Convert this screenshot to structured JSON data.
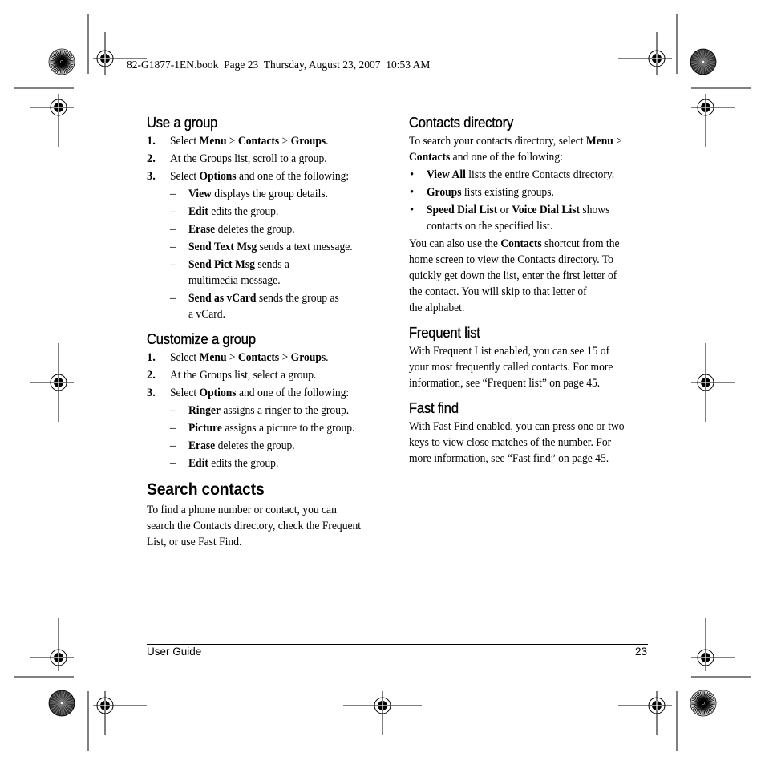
{
  "slug_line": "82-G1877-1EN.book  Page 23  Thursday, August 23, 2007  10:53 AM",
  "left_column": {
    "use_group": {
      "heading": "Use a group",
      "steps": [
        {
          "num": "1.",
          "parts": [
            {
              "t": "Select "
            },
            {
              "b": "Menu"
            },
            {
              "t": " > "
            },
            {
              "b": "Contacts"
            },
            {
              "t": " > "
            },
            {
              "b": "Groups"
            },
            {
              "t": "."
            }
          ]
        },
        {
          "num": "2.",
          "parts": [
            {
              "t": "At the Groups list, scroll to a group."
            }
          ]
        },
        {
          "num": "3.",
          "parts": [
            {
              "t": "Select "
            },
            {
              "b": "Options"
            },
            {
              "t": " and one of the following:"
            }
          ],
          "subs": [
            {
              "bold": "View",
              "rest": " displays the group details."
            },
            {
              "bold": "Edit",
              "rest": " edits the group."
            },
            {
              "bold": "Erase",
              "rest": " deletes the group."
            },
            {
              "bold": "Send Text Msg",
              "rest": " sends a text message."
            },
            {
              "bold": "Send Pict Msg",
              "rest": " sends a",
              "line2": "multimedia message."
            },
            {
              "bold": "Send as vCard",
              "rest": " sends the group as",
              "line2": "a vCard."
            }
          ]
        }
      ]
    },
    "customize_group": {
      "heading": "Customize a group",
      "steps": [
        {
          "num": "1.",
          "parts": [
            {
              "t": "Select "
            },
            {
              "b": "Menu"
            },
            {
              "t": " > "
            },
            {
              "b": "Contacts"
            },
            {
              "t": " > "
            },
            {
              "b": "Groups"
            },
            {
              "t": "."
            }
          ]
        },
        {
          "num": "2.",
          "parts": [
            {
              "t": "At the Groups list, select a group."
            }
          ]
        },
        {
          "num": "3.",
          "parts": [
            {
              "t": "Select "
            },
            {
              "b": "Options"
            },
            {
              "t": " and one of the following:"
            }
          ],
          "subs": [
            {
              "bold": "Ringer",
              "rest": " assigns a ringer to the group."
            },
            {
              "bold": "Picture",
              "rest": " assigns a picture to the group."
            },
            {
              "bold": "Erase",
              "rest": " deletes the group."
            },
            {
              "bold": "Edit",
              "rest": " edits the group."
            }
          ]
        }
      ]
    },
    "search_contacts": {
      "heading": "Search contacts",
      "lines": [
        "To find a phone number or contact, you can",
        "search the Contacts directory, check the Frequent",
        "List, or use Fast Find."
      ]
    }
  },
  "right_column": {
    "contacts_directory": {
      "heading": "Contacts directory",
      "intro_lines": [
        [
          {
            "t": "To search your contacts directory, select "
          },
          {
            "b": "Menu"
          },
          {
            "t": " >"
          }
        ],
        [
          {
            "b": "Contacts"
          },
          {
            "t": " and one of the following:"
          }
        ]
      ],
      "bullets": [
        {
          "lines": [
            [
              {
                "b": "View All"
              },
              {
                "t": " lists the entire Contacts directory."
              }
            ]
          ]
        },
        {
          "lines": [
            [
              {
                "b": "Groups"
              },
              {
                "t": " lists existing groups."
              }
            ]
          ]
        },
        {
          "lines": [
            [
              {
                "b": "Speed Dial List"
              },
              {
                "t": " or "
              },
              {
                "b": "Voice Dial List"
              },
              {
                "t": " shows"
              }
            ],
            [
              {
                "t": "contacts on the specified list."
              }
            ]
          ]
        }
      ],
      "para_lines": [
        [
          {
            "t": "You can also use the "
          },
          {
            "b": "Contacts"
          },
          {
            "t": " shortcut from the"
          }
        ],
        [
          {
            "t": "home screen to view the Contacts directory. To"
          }
        ],
        [
          {
            "t": "quickly get down the list, enter the first letter of"
          }
        ],
        [
          {
            "t": "the contact. You will skip to that letter of"
          }
        ],
        [
          {
            "t": "the alphabet."
          }
        ]
      ]
    },
    "frequent_list": {
      "heading": "Frequent list",
      "lines": [
        "With Frequent List enabled, you can see 15 of",
        "your most frequently called contacts. For more",
        "information, see “Frequent list” on page 45."
      ]
    },
    "fast_find": {
      "heading": "Fast find",
      "lines": [
        "With Fast Find enabled, you can press one or two",
        "keys to view close matches of the number. For",
        "more information, see “Fast find” on page 45."
      ]
    }
  },
  "footer": {
    "title": "User Guide",
    "page_number": "23"
  },
  "bullet_glyph": "•",
  "dash_glyph": "–"
}
